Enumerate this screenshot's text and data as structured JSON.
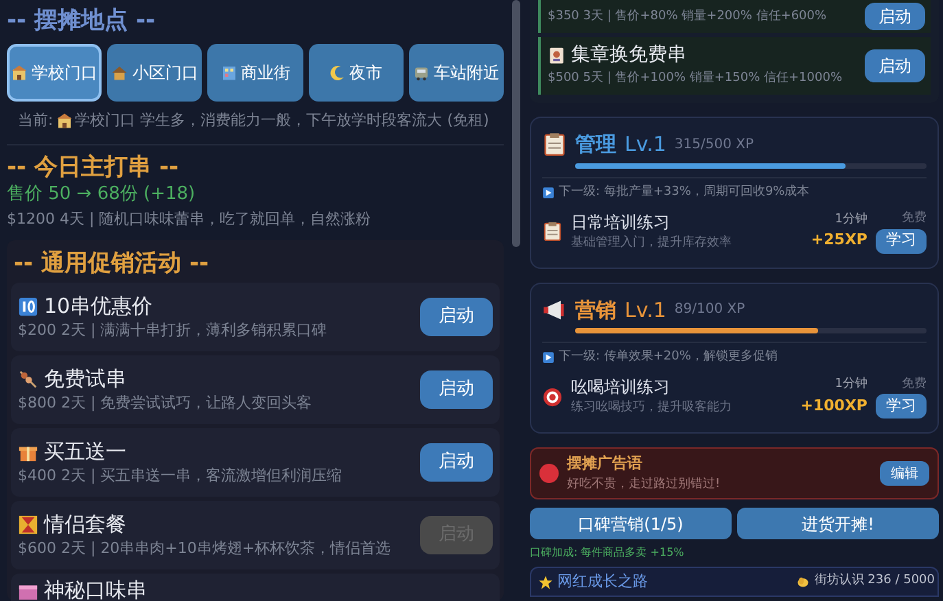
{
  "locations": {
    "title": "-- 摆摊地点 --",
    "options": [
      {
        "label": "学校门口",
        "selected": true
      },
      {
        "label": "小区门口",
        "selected": false
      },
      {
        "label": "商业街",
        "selected": false
      },
      {
        "label": "夜市",
        "selected": false
      },
      {
        "label": "车站附近",
        "selected": false
      }
    ],
    "current_label": "当前:",
    "current_text": "学校门口  学生多，消费能力一般，下午放学时段客流大 (免租)"
  },
  "featured": {
    "title": "-- 今日主打串 --",
    "price": "售价 50 → 68份 (+18)",
    "desc": "$1200 4天 | 随机口味味蕾串，吃了就回单，自然涨粉"
  },
  "promotions": {
    "title": "-- 通用促销活动 --",
    "items": [
      {
        "name": "10串优惠价",
        "desc": "$200 2天 | 满满十串打折，薄利多销积累口碑",
        "button": "启动",
        "disabled": false
      },
      {
        "name": "免费试串",
        "desc": "$800 2天 | 免费尝试试巧，让路人变回头客",
        "button": "启动",
        "disabled": false
      },
      {
        "name": "买五送一",
        "desc": "$400 2天 | 买五串送一串，客流激增但利润压缩",
        "button": "启动",
        "disabled": false
      },
      {
        "name": "情侣套餐",
        "desc": "$600 2天 | 20串串肉+10串烤翅+杯杯饮茶，情侣首选",
        "button": "启动",
        "disabled": true
      },
      {
        "name": "神秘口味串"
      }
    ]
  },
  "special_promotions": [
    {
      "desc": "$350 3天 | 售价+80% 销量+200% 信任+600%",
      "button": "启动"
    },
    {
      "name": "集章换免费串",
      "desc": "$500 5天 | 售价+100% 销量+150% 信任+1000%",
      "button": "启动"
    }
  ],
  "skills": [
    {
      "name": "管理",
      "level_text": "Lv.1",
      "xp": "315/500 XP",
      "level": 0.77,
      "color": "#4a9be0",
      "next": "下一级: 每批产量+33%，周期可回收9%成本",
      "training": {
        "name": "日常培训练习",
        "desc": "基础管理入门，提升库存效率",
        "time": "1分钟",
        "cost": "免费",
        "reward": "+25XP",
        "button": "学习"
      }
    },
    {
      "name": "营销",
      "level_text": "Lv.1",
      "xp": "89/100 XP",
      "level": 0.69,
      "color": "#e8943a",
      "next": "下一级: 传单效果+20%，解锁更多促销",
      "training": {
        "name": "吆喝培训练习",
        "desc": "练习吆喝技巧，提升吸客能力",
        "time": "1分钟",
        "cost": "免费",
        "reward": "+100XP",
        "button": "学习"
      }
    }
  ],
  "slogan": {
    "title": "摆摊广告语",
    "text": "好吃不贵，走过路过别错过!",
    "button": "编辑"
  },
  "actions": [
    "口碑营销(1/5)",
    "进货开摊!"
  ],
  "bonus": "口碑加成: 每件商品多卖 +15%",
  "growth": {
    "title": "网红成长之路",
    "stat": "街坊认识 236 / 5000"
  }
}
